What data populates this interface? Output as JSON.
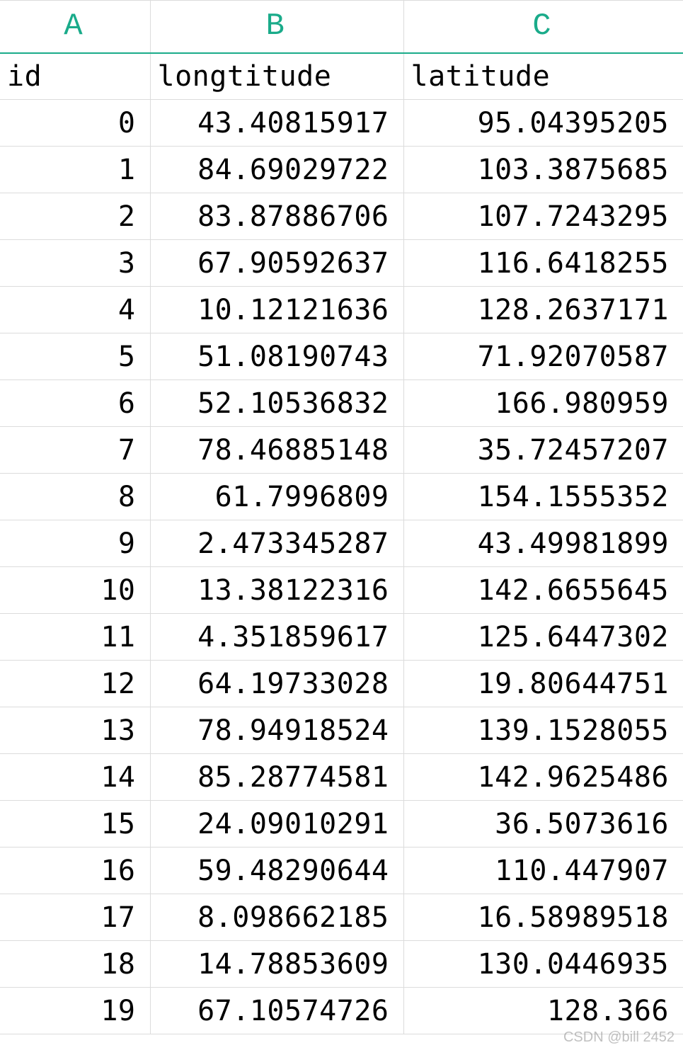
{
  "columns": {
    "a": "A",
    "b": "B",
    "c": "C"
  },
  "headers": {
    "id": "id",
    "longtitude": "longtitude",
    "latitude": "latitude"
  },
  "rows": [
    {
      "id": "0",
      "long": "43.40815917",
      "lat": "95.04395205"
    },
    {
      "id": "1",
      "long": "84.69029722",
      "lat": "103.3875685"
    },
    {
      "id": "2",
      "long": "83.87886706",
      "lat": "107.7243295"
    },
    {
      "id": "3",
      "long": "67.90592637",
      "lat": "116.6418255"
    },
    {
      "id": "4",
      "long": "10.12121636",
      "lat": "128.2637171"
    },
    {
      "id": "5",
      "long": "51.08190743",
      "lat": "71.92070587"
    },
    {
      "id": "6",
      "long": "52.10536832",
      "lat": "166.980959"
    },
    {
      "id": "7",
      "long": "78.46885148",
      "lat": "35.72457207"
    },
    {
      "id": "8",
      "long": "61.7996809",
      "lat": "154.1555352"
    },
    {
      "id": "9",
      "long": "2.473345287",
      "lat": "43.49981899"
    },
    {
      "id": "10",
      "long": "13.38122316",
      "lat": "142.6655645"
    },
    {
      "id": "11",
      "long": "4.351859617",
      "lat": "125.6447302"
    },
    {
      "id": "12",
      "long": "64.19733028",
      "lat": "19.80644751"
    },
    {
      "id": "13",
      "long": "78.94918524",
      "lat": "139.1528055"
    },
    {
      "id": "14",
      "long": "85.28774581",
      "lat": "142.9625486"
    },
    {
      "id": "15",
      "long": "24.09010291",
      "lat": "36.5073616"
    },
    {
      "id": "16",
      "long": "59.48290644",
      "lat": "110.447907"
    },
    {
      "id": "17",
      "long": "8.098662185",
      "lat": "16.58989518"
    },
    {
      "id": "18",
      "long": "14.78853609",
      "lat": "130.0446935"
    },
    {
      "id": "19",
      "long": "67.10574726",
      "lat": "128.366"
    }
  ],
  "watermark": "CSDN @bill 2452"
}
